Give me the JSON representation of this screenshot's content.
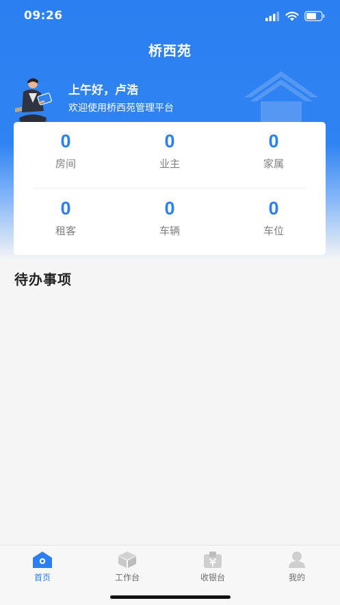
{
  "status_bar": {
    "time": "09:26"
  },
  "header": {
    "title": "桥西苑"
  },
  "greeting": {
    "hello": "上午好，卢浩",
    "welcome": "欢迎使用桥西苑管理平台"
  },
  "stats": [
    {
      "value": "0",
      "label": "房间"
    },
    {
      "value": "0",
      "label": "业主"
    },
    {
      "value": "0",
      "label": "家属"
    },
    {
      "value": "0",
      "label": "租客"
    },
    {
      "value": "0",
      "label": "车辆"
    },
    {
      "value": "0",
      "label": "车位"
    }
  ],
  "todo": {
    "title": "待办事项"
  },
  "tab_bar": {
    "tabs": [
      {
        "label": "首页",
        "icon": "home-icon",
        "active": true
      },
      {
        "label": "工作台",
        "icon": "box-icon",
        "active": false
      },
      {
        "label": "收银台",
        "icon": "cashier-icon",
        "active": false
      },
      {
        "label": "我的",
        "icon": "user-icon",
        "active": false
      }
    ]
  },
  "colors": {
    "primary": "#2b7ff0",
    "inactive_icon": "#cfcfcf",
    "background": "#f5f5f5"
  }
}
